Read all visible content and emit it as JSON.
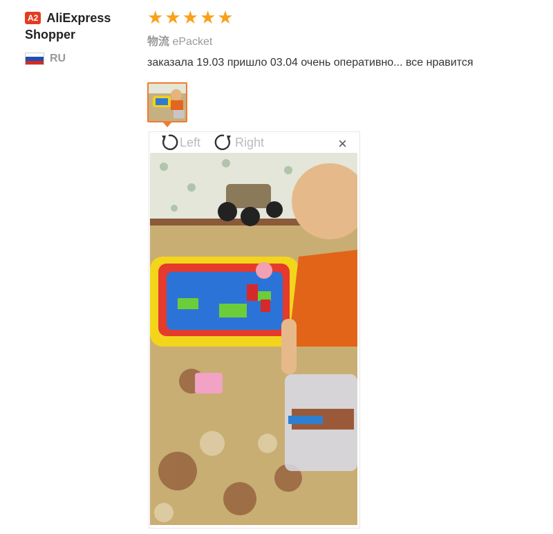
{
  "reviewer": {
    "level_badge": "A2",
    "name_line1": "AliExpress",
    "name_line2": "Shopper",
    "country_code": "RU",
    "flag_colors": [
      "#ffffff",
      "#1c4fb8",
      "#d52b1e"
    ]
  },
  "review": {
    "rating": 5,
    "star_color": "#f7a21b",
    "logistics_label": "物流",
    "logistics_value": "ePacket",
    "text": "заказала 19.03 пришло 03.04 очень оперативно... все нравится"
  },
  "viewer": {
    "rotate_left_label": "Left",
    "rotate_right_label": "Right",
    "close_label": "×",
    "photo_icon": "photo-of-child-playing-with-sand-set"
  },
  "colors": {
    "accent": "#f27a31",
    "badge": "#e43c20"
  }
}
